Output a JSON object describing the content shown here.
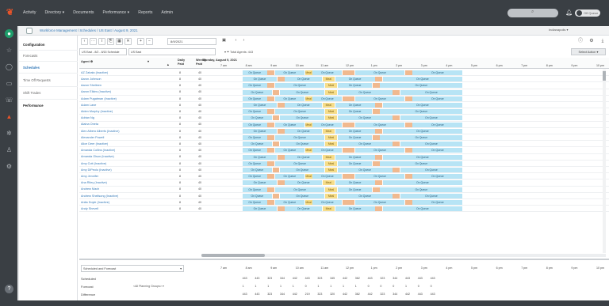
{
  "topnav": {
    "items": [
      "Activity",
      "Directory ▾",
      "Documents",
      "Performance ▾",
      "Reports",
      "Admin"
    ],
    "toggle_label": "Off Queue"
  },
  "breadcrumb": "Workforce Management / Schedules / US East / August 9, 2021",
  "location_select": "Indianapolis",
  "side": {
    "configuration": "Configuration",
    "forecasts": "Forecasts",
    "schedules": "Schedules",
    "time_off_requests": "Time Off Requests",
    "shift_trades": "Shift Trades",
    "performance": "Performance"
  },
  "toolbar": {
    "date": "8/9/2021",
    "filter_left": "US East - 8/2 - 8/15 Schedule",
    "filter_right": "US East",
    "total_agents": "Total Agents: 443",
    "select_action": "Select Action ▾"
  },
  "grid": {
    "col_agent": "Agent",
    "col_daily": "Daily Paid",
    "col_weekly": "Weekly Paid",
    "day_header": "Monday, August 9, 2021",
    "ticks": [
      "7 am",
      "8 am",
      "9 am",
      "10 am",
      "11 am",
      "12 pm",
      "1 pm",
      "2 pm",
      "3 pm",
      "4 pm",
      "5 pm",
      "6 pm",
      "7 pm",
      "8 pm",
      "9 pm",
      "10 pm",
      "11 p"
    ],
    "queue_label": "On Queue",
    "meal_label": "Meal",
    "rows": [
      {
        "name": "AZ Zabala (Inactive)",
        "daily": "8",
        "weekly": "40"
      },
      {
        "name": "Aaron Johnson",
        "daily": "8",
        "weekly": "40"
      },
      {
        "name": "Aaron Shelleen",
        "daily": "8",
        "weekly": "40"
      },
      {
        "name": "Aaron Elkins (Inactive)",
        "daily": "8",
        "weekly": "40"
      },
      {
        "name": "Adam Pugatman (Inactive)",
        "daily": "8",
        "weekly": "40"
      },
      {
        "name": "Adam Lane",
        "daily": "8",
        "weekly": "40"
      },
      {
        "name": "Aiden Murphy (Inactive)",
        "daily": "8",
        "weekly": "40"
      },
      {
        "name": "Adrian Ng",
        "daily": "8",
        "weekly": "40"
      },
      {
        "name": "Alaina Oneta",
        "daily": "8",
        "weekly": "40"
      },
      {
        "name": "Alex Albero Alberts (Inactive)",
        "daily": "8",
        "weekly": "40"
      },
      {
        "name": "Alexander Powell",
        "daily": "8",
        "weekly": "40"
      },
      {
        "name": "Alice Deer (Inactive)",
        "daily": "8",
        "weekly": "40"
      },
      {
        "name": "Amanda Collins (Inactive)",
        "daily": "8",
        "weekly": "40"
      },
      {
        "name": "Amanda Olson (Inactive)",
        "daily": "8",
        "weekly": "40"
      },
      {
        "name": "Amy Cott (Inactive)",
        "daily": "8",
        "weekly": "40"
      },
      {
        "name": "Amy DiPeolo (Inactive)",
        "daily": "8",
        "weekly": "40"
      },
      {
        "name": "Amy Jennifer",
        "daily": "8",
        "weekly": "40"
      },
      {
        "name": "Ana Riley (Inactive)",
        "daily": "8",
        "weekly": "40"
      },
      {
        "name": "Andrew Mach",
        "daily": "8",
        "weekly": "40"
      },
      {
        "name": "Andrew Shellsong (Inactive)",
        "daily": "8",
        "weekly": "40"
      },
      {
        "name": "Anita Doyle (Inactive)",
        "daily": "8",
        "weekly": "40"
      },
      {
        "name": "Andy Shevell",
        "daily": "8",
        "weekly": "40"
      }
    ]
  },
  "bottom": {
    "select": "Scheduled and Forecast",
    "ticks": [
      "7 am",
      "8 am",
      "9 am",
      "10 am",
      "11 am",
      "12 pm",
      "1 pm",
      "2 pm",
      "3 pm",
      "4 pm",
      "5 pm",
      "6 pm",
      "7 pm",
      "8 pm",
      "9 pm",
      "10 pm",
      "11 p"
    ],
    "rows": [
      {
        "label": "Scheduled",
        "values": [
          "443",
          "443",
          "323",
          "344",
          "442",
          "443",
          "323",
          "345",
          "442",
          "362",
          "443",
          "323",
          "344",
          "443",
          "443",
          "443"
        ]
      },
      {
        "label": "Forecast",
        "values": [
          "1",
          "1",
          "1",
          "1",
          "1",
          "0",
          "1",
          "1",
          "1",
          "1",
          "0",
          "0",
          "0",
          "1",
          "0",
          "0"
        ]
      },
      {
        "label": "Difference",
        "values": [
          "443",
          "443",
          "323",
          "344",
          "442",
          "219",
          "323",
          "320",
          "442",
          "362",
          "442",
          "323",
          "344",
          "442",
          "443",
          "443"
        ]
      }
    ],
    "planning": "<All Planning Groups> ▾"
  }
}
